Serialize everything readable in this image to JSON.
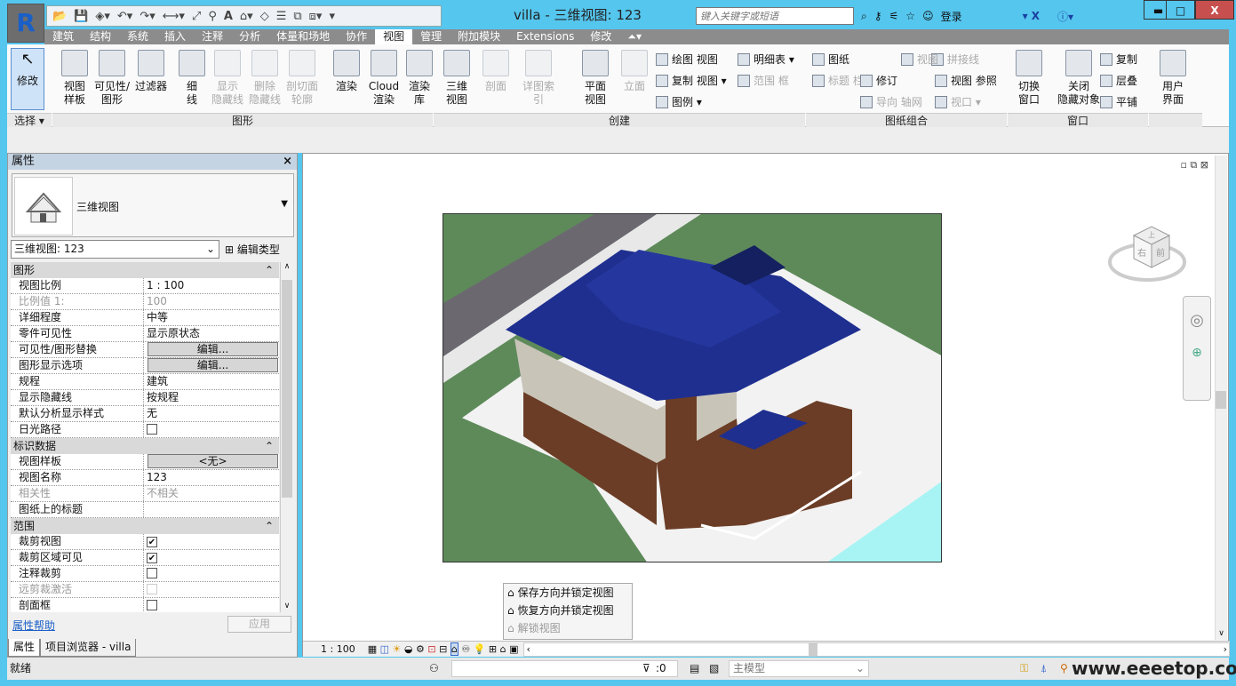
{
  "window": {
    "title": "villa - 三维视图: 123",
    "min": "▬",
    "max": "□",
    "close": "X"
  },
  "app_button": "R",
  "search": {
    "placeholder": "键入关键字或短语",
    "login": "登录"
  },
  "tabs": [
    "建筑",
    "结构",
    "系统",
    "插入",
    "注释",
    "分析",
    "体量和场地",
    "协作",
    "视图",
    "管理",
    "附加模块",
    "Extensions",
    "修改"
  ],
  "active_tab": "视图",
  "ribbon": {
    "select_group": {
      "modify": "修改",
      "label": "选择 ▾"
    },
    "graphics": {
      "label": "图形",
      "items": [
        "视图\n样板",
        "可见性/\n图形",
        "过滤器",
        "细\n线",
        "显示\n隐藏线",
        "删除\n隐藏线",
        "剖切面\n轮廓"
      ],
      "disabled": [
        false,
        false,
        false,
        false,
        true,
        true,
        true
      ]
    },
    "presentation": {
      "items": [
        "渲染",
        "Cloud\n渲染",
        "渲染\n库"
      ]
    },
    "create": {
      "label": "创建",
      "items": [
        "三维\n视图",
        "剖面",
        "详图索引",
        "平面\n视图",
        "立面"
      ],
      "small": [
        "绘图 视图",
        "复制 视图 ▾",
        "图例 ▾",
        "明细表 ▾",
        "范围 框"
      ]
    },
    "sheet": {
      "label": "图纸组合",
      "small": [
        "图纸",
        "标题 栏",
        "拼接线",
        "视图",
        "修订",
        "视图 参照",
        "导向 轴网",
        "视口 ▾"
      ]
    },
    "window": {
      "label": "窗口",
      "items": [
        "切换\n窗口",
        "关闭\n隐藏对象"
      ],
      "small": [
        "复制",
        "层叠",
        "平铺"
      ]
    },
    "ui": {
      "items": [
        "用户\n界面"
      ]
    }
  },
  "properties": {
    "title": "属性",
    "close": "×",
    "type_name": "三维视图",
    "view_selector": "三维视图: 123",
    "edit_type": "编辑类型",
    "sections": [
      {
        "name": "图形",
        "rows": [
          {
            "k": "视图比例",
            "v": "1 : 100"
          },
          {
            "k": "比例值 1:",
            "v": "100",
            "gray": true
          },
          {
            "k": "详细程度",
            "v": "中等"
          },
          {
            "k": "零件可见性",
            "v": "显示原状态"
          },
          {
            "k": "可见性/图形替换",
            "v": "编辑...",
            "button": true
          },
          {
            "k": "图形显示选项",
            "v": "编辑...",
            "button": true
          },
          {
            "k": "规程",
            "v": "建筑"
          },
          {
            "k": "显示隐藏线",
            "v": "按规程"
          },
          {
            "k": "默认分析显示样式",
            "v": "无"
          },
          {
            "k": "日光路径",
            "check": false
          }
        ]
      },
      {
        "name": "标识数据",
        "rows": [
          {
            "k": "视图样板",
            "v": "<无>",
            "button": true
          },
          {
            "k": "视图名称",
            "v": "123"
          },
          {
            "k": "相关性",
            "v": "不相关",
            "gray": true
          },
          {
            "k": "图纸上的标题",
            "v": ""
          }
        ]
      },
      {
        "name": "范围",
        "rows": [
          {
            "k": "裁剪视图",
            "check": true
          },
          {
            "k": "裁剪区域可见",
            "check": true
          },
          {
            "k": "注释裁剪",
            "check": false
          },
          {
            "k": "远剪裁激活",
            "check": false,
            "gray": true
          },
          {
            "k": "剖面框",
            "check": false
          }
        ]
      }
    ],
    "help": "属性帮助",
    "apply": "应用",
    "tab_props": "属性",
    "tab_browser": "项目浏览器 - villa"
  },
  "view_control": {
    "scale": "1 : 100"
  },
  "lock_menu": [
    "保存方向并锁定视图",
    "恢复方向并锁定视图",
    "解锁视图"
  ],
  "viewcube": {
    "top": "上",
    "front": "前",
    "right": "右"
  },
  "status": {
    "text": "就绪",
    "selection_count": ":0",
    "model": "主模型",
    "watermark": "www.eeeetop.com"
  },
  "colors": {
    "roof": "#1f2f8f",
    "wall": "#6b3d26",
    "ground": "#5e8a5a",
    "road": "#6b6870",
    "water": "#a8f4f4"
  }
}
